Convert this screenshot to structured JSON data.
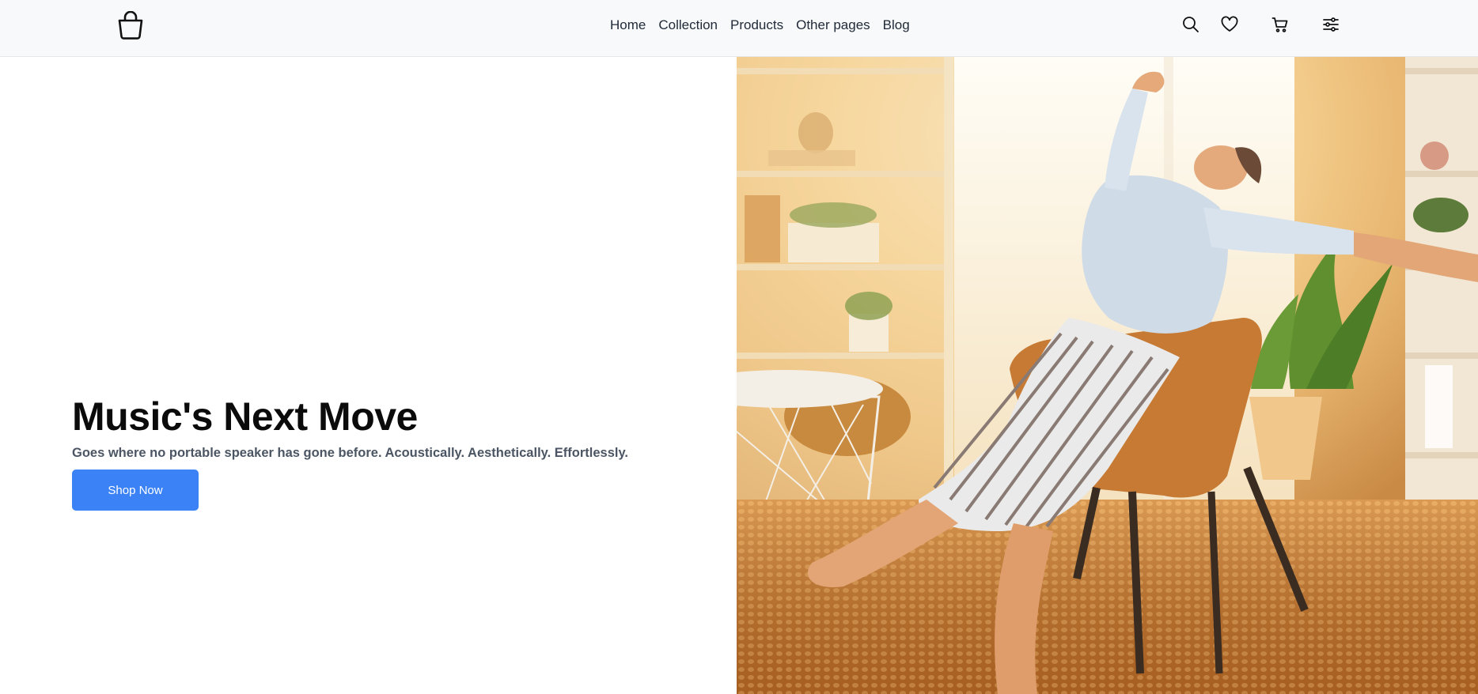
{
  "header": {
    "logo_icon": "shopping-bag-icon",
    "nav": [
      {
        "label": "Home"
      },
      {
        "label": "Collection"
      },
      {
        "label": "Products"
      },
      {
        "label": "Other pages"
      },
      {
        "label": "Blog"
      }
    ],
    "actions": [
      {
        "icon": "search-icon"
      },
      {
        "icon": "heart-icon"
      },
      {
        "icon": "cart-icon"
      },
      {
        "icon": "sliders-icon"
      }
    ]
  },
  "hero": {
    "title": "Music's Next Move",
    "subtitle": "Goes where no portable speaker has gone before. Acoustically. Aesthetically. Effortlessly.",
    "cta_label": "Shop Now",
    "image_subject": "woman-relaxing-in-chair-photo"
  },
  "colors": {
    "accent": "#3b82f6",
    "header_bg": "#f8f9fa"
  }
}
